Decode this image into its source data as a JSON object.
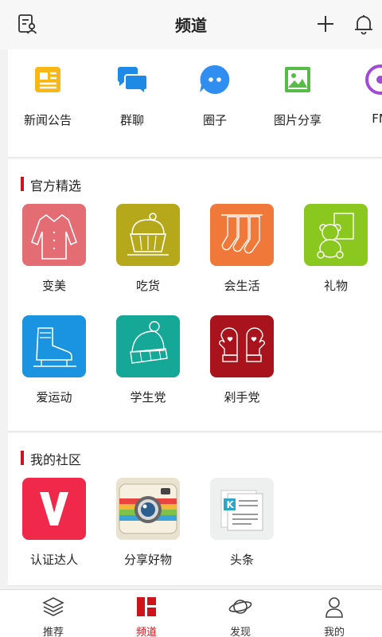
{
  "header": {
    "title": "频道",
    "profile_icon": "profile-doc-icon",
    "add_icon": "plus-icon",
    "bell_icon": "bell-icon"
  },
  "quick_links": [
    {
      "label": "新闻公告",
      "icon": "news-icon",
      "color": "#f8b715"
    },
    {
      "label": "群聊",
      "icon": "chat-icon",
      "color": "#1e8ae6"
    },
    {
      "label": "圈子",
      "icon": "circle-chat-icon",
      "color": "#2f8ef0"
    },
    {
      "label": "图片分享",
      "icon": "image-icon",
      "color": "#55bd46"
    },
    {
      "label": "FM",
      "icon": "fm-icon",
      "color": "#a04ad8"
    }
  ],
  "official": {
    "title": "官方精选",
    "items": [
      {
        "label": "变美",
        "icon": "coat-icon",
        "color": "#e46c73"
      },
      {
        "label": "吃货",
        "icon": "cupcake-icon",
        "color": "#b5a81a"
      },
      {
        "label": "会生活",
        "icon": "stockings-icon",
        "color": "#f07838"
      },
      {
        "label": "礼物",
        "icon": "teddy-bear-icon",
        "color": "#8ac820"
      },
      {
        "label": "爱运动",
        "icon": "ice-skate-icon",
        "color": "#1a93e0"
      },
      {
        "label": "学生党",
        "icon": "beanie-icon",
        "color": "#15a896"
      },
      {
        "label": "剁手党",
        "icon": "mittens-icon",
        "color": "#a9131b"
      }
    ]
  },
  "community": {
    "title": "我的社区",
    "items": [
      {
        "label": "认证达人",
        "icon": "v-logo-icon",
        "color": "#f0284a"
      },
      {
        "label": "分享好物",
        "icon": "camera-icon",
        "color": "#e8e2cf"
      },
      {
        "label": "头条",
        "icon": "headline-icon",
        "color": "#eef0ef"
      }
    ]
  },
  "tabs": [
    {
      "label": "推荐",
      "icon": "layers-icon"
    },
    {
      "label": "频道",
      "icon": "channel-grid-icon",
      "active": true
    },
    {
      "label": "发现",
      "icon": "planet-icon"
    },
    {
      "label": "我的",
      "icon": "person-icon"
    }
  ],
  "accent": "#d0121b"
}
